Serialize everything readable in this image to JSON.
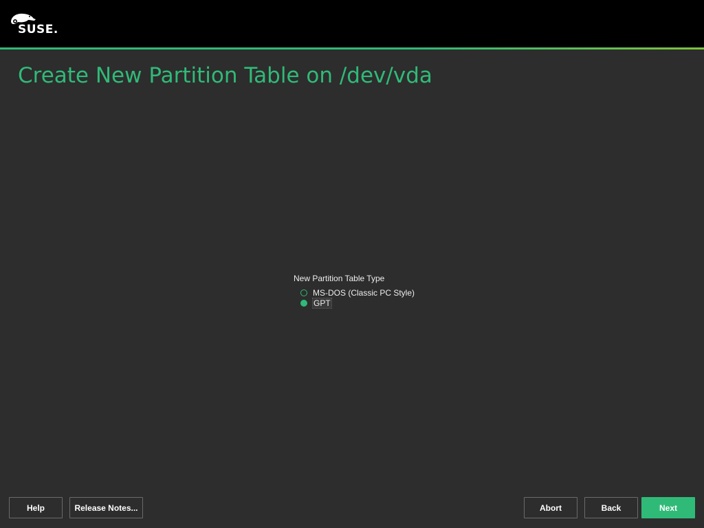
{
  "header": {
    "logo_text": "SUSE.",
    "accent_color": "#30ba78",
    "background": "#000000"
  },
  "page": {
    "title": "Create New Partition Table on /dev/vda"
  },
  "partition_type": {
    "group_label": "New Partition Table Type",
    "options": [
      {
        "label": "MS-DOS (Classic PC Style)",
        "checked": false
      },
      {
        "label": "GPT",
        "checked": true
      }
    ]
  },
  "buttons": {
    "help": "Help",
    "release_notes": "Release Notes...",
    "abort": "Abort",
    "back": "Back",
    "next": "Next"
  },
  "icons": {
    "logo": "suse-chameleon-logo",
    "radio_unchecked": "radio-unchecked-icon",
    "radio_checked": "radio-checked-icon"
  }
}
